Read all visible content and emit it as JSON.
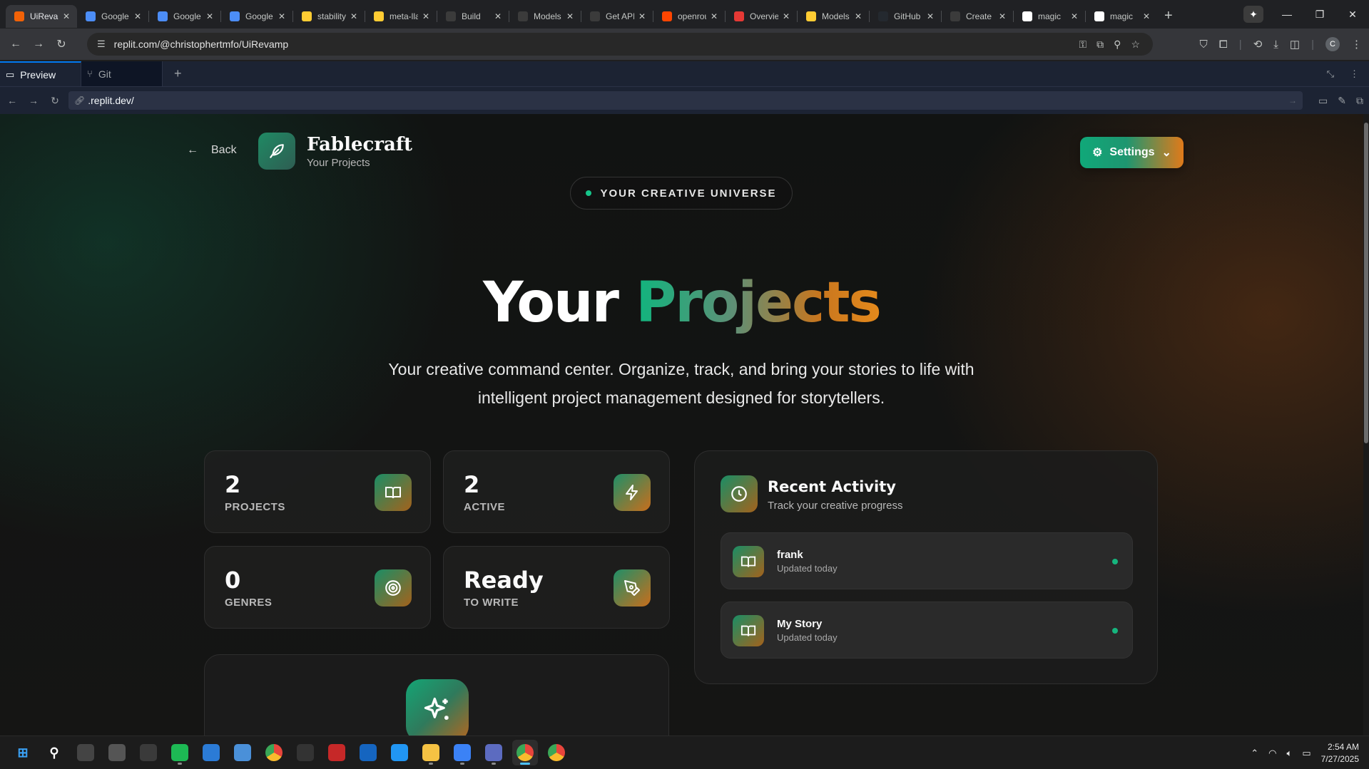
{
  "browser": {
    "tabs": [
      {
        "title": "UiRevamp",
        "active": true,
        "favicon": "replit-icon",
        "color": "#f26207"
      },
      {
        "title": "Google AI Studio",
        "active": false,
        "favicon": "gemini-icon",
        "color": "#4c8df6"
      },
      {
        "title": "Google AI Studio",
        "active": false,
        "favicon": "gemini-icon",
        "color": "#4c8df6"
      },
      {
        "title": "Google AI Studio",
        "active": false,
        "favicon": "gemini-icon",
        "color": "#4c8df6"
      },
      {
        "title": "stability",
        "active": false,
        "favicon": "huggingface-icon",
        "color": "#ffcc33"
      },
      {
        "title": "meta-llama",
        "active": false,
        "favicon": "huggingface-icon",
        "color": "#ffcc33"
      },
      {
        "title": "Build",
        "active": false,
        "favicon": "openai-icon",
        "color": "#3b3b3b"
      },
      {
        "title": "Models",
        "active": false,
        "favicon": "openrouter-icon",
        "color": "#3b3b3b"
      },
      {
        "title": "Get API",
        "active": false,
        "favicon": "openai-icon",
        "color": "#3b3b3b"
      },
      {
        "title": "openrouter",
        "active": false,
        "favicon": "reddit-icon",
        "color": "#ff4500"
      },
      {
        "title": "Overview",
        "active": false,
        "favicon": "notification-icon",
        "color": "#e53935"
      },
      {
        "title": "Models",
        "active": false,
        "favicon": "huggingface-icon",
        "color": "#ffcc33"
      },
      {
        "title": "GitHub",
        "active": false,
        "favicon": "github-icon",
        "color": "#24292f"
      },
      {
        "title": "Create",
        "active": false,
        "favicon": "openrouter-icon",
        "color": "#3b3b3b"
      },
      {
        "title": "magic",
        "active": false,
        "favicon": "google-icon",
        "color": "#ffffff"
      },
      {
        "title": "magic",
        "active": false,
        "favicon": "google-icon",
        "color": "#ffffff"
      }
    ],
    "url": "replit.com/@christophertmfo/UiRevamp",
    "profile_initial": "C"
  },
  "replit": {
    "pane_tabs": [
      {
        "label": "Preview",
        "icon": "monitor-icon",
        "active": true
      },
      {
        "label": "Git",
        "icon": "git-icon",
        "active": false
      }
    ],
    "webview_url": ".replit.dev/"
  },
  "app": {
    "back_label": "Back",
    "brand_name": "Fablecraft",
    "brand_subtitle": "Your Projects",
    "settings_label": "Settings",
    "badge_text": "YOUR CREATIVE UNIVERSE",
    "hero_title_plain": "Your",
    "hero_title_gradient": "Projects",
    "hero_description": "Your creative command center. Organize, track, and bring your stories to life with intelligent project management designed for storytellers.",
    "stats": [
      {
        "value": "2",
        "label": "PROJECTS",
        "icon": "book-open-icon",
        "color": "#1a8e66"
      },
      {
        "value": "2",
        "label": "ACTIVE",
        "icon": "lightning-icon",
        "color": "#2a7a5c"
      },
      {
        "value": "0",
        "label": "GENRES",
        "icon": "target-icon",
        "color": "#1a8e66"
      },
      {
        "value": "Ready",
        "label": "TO WRITE",
        "icon": "pen-tool-icon",
        "color": "#2a7a5c"
      }
    ],
    "activity": {
      "title": "Recent Activity",
      "subtitle": "Track your creative progress",
      "items": [
        {
          "name": "frank",
          "time": "Updated today"
        },
        {
          "name": "My Story",
          "time": "Updated today"
        }
      ]
    },
    "accent_green": "#10a879",
    "accent_orange": "#e07a1a"
  },
  "taskbar": {
    "apps": [
      {
        "name": "start-icon",
        "label": "",
        "color": "#3aa0f3"
      },
      {
        "name": "search-icon",
        "label": "",
        "color": "#1c1c1c"
      },
      {
        "name": "app-icon",
        "label": "",
        "color": "#444"
      },
      {
        "name": "app-icon",
        "label": "",
        "color": "#555"
      },
      {
        "name": "app-icon",
        "label": "",
        "color": "#3a3a3a"
      },
      {
        "name": "spotify-icon",
        "label": "",
        "color": "#1db954"
      },
      {
        "name": "vscode-icon",
        "label": "",
        "color": "#2b7bd6"
      },
      {
        "name": "photos-icon",
        "label": "",
        "color": "#4a90d9"
      },
      {
        "name": "chrome-icon",
        "label": "",
        "color": "#e8453c"
      },
      {
        "name": "app-icon",
        "label": "",
        "color": "#333"
      },
      {
        "name": "app-icon",
        "label": "",
        "color": "#c62828"
      },
      {
        "name": "app-icon",
        "label": "",
        "color": "#1565c0"
      },
      {
        "name": "app-icon",
        "label": "",
        "color": "#2196f3"
      },
      {
        "name": "file-explorer-icon",
        "label": "",
        "color": "#f5c243"
      },
      {
        "name": "notepad-icon",
        "label": "",
        "color": "#3b82f6"
      },
      {
        "name": "calculator-icon",
        "label": "",
        "color": "#5c6bc0"
      },
      {
        "name": "chrome-icon",
        "label": "",
        "color": "#e8453c"
      },
      {
        "name": "chrome-icon",
        "label": "",
        "color": "#e8453c"
      }
    ],
    "time": "2:54 AM",
    "date": "7/27/2025"
  }
}
